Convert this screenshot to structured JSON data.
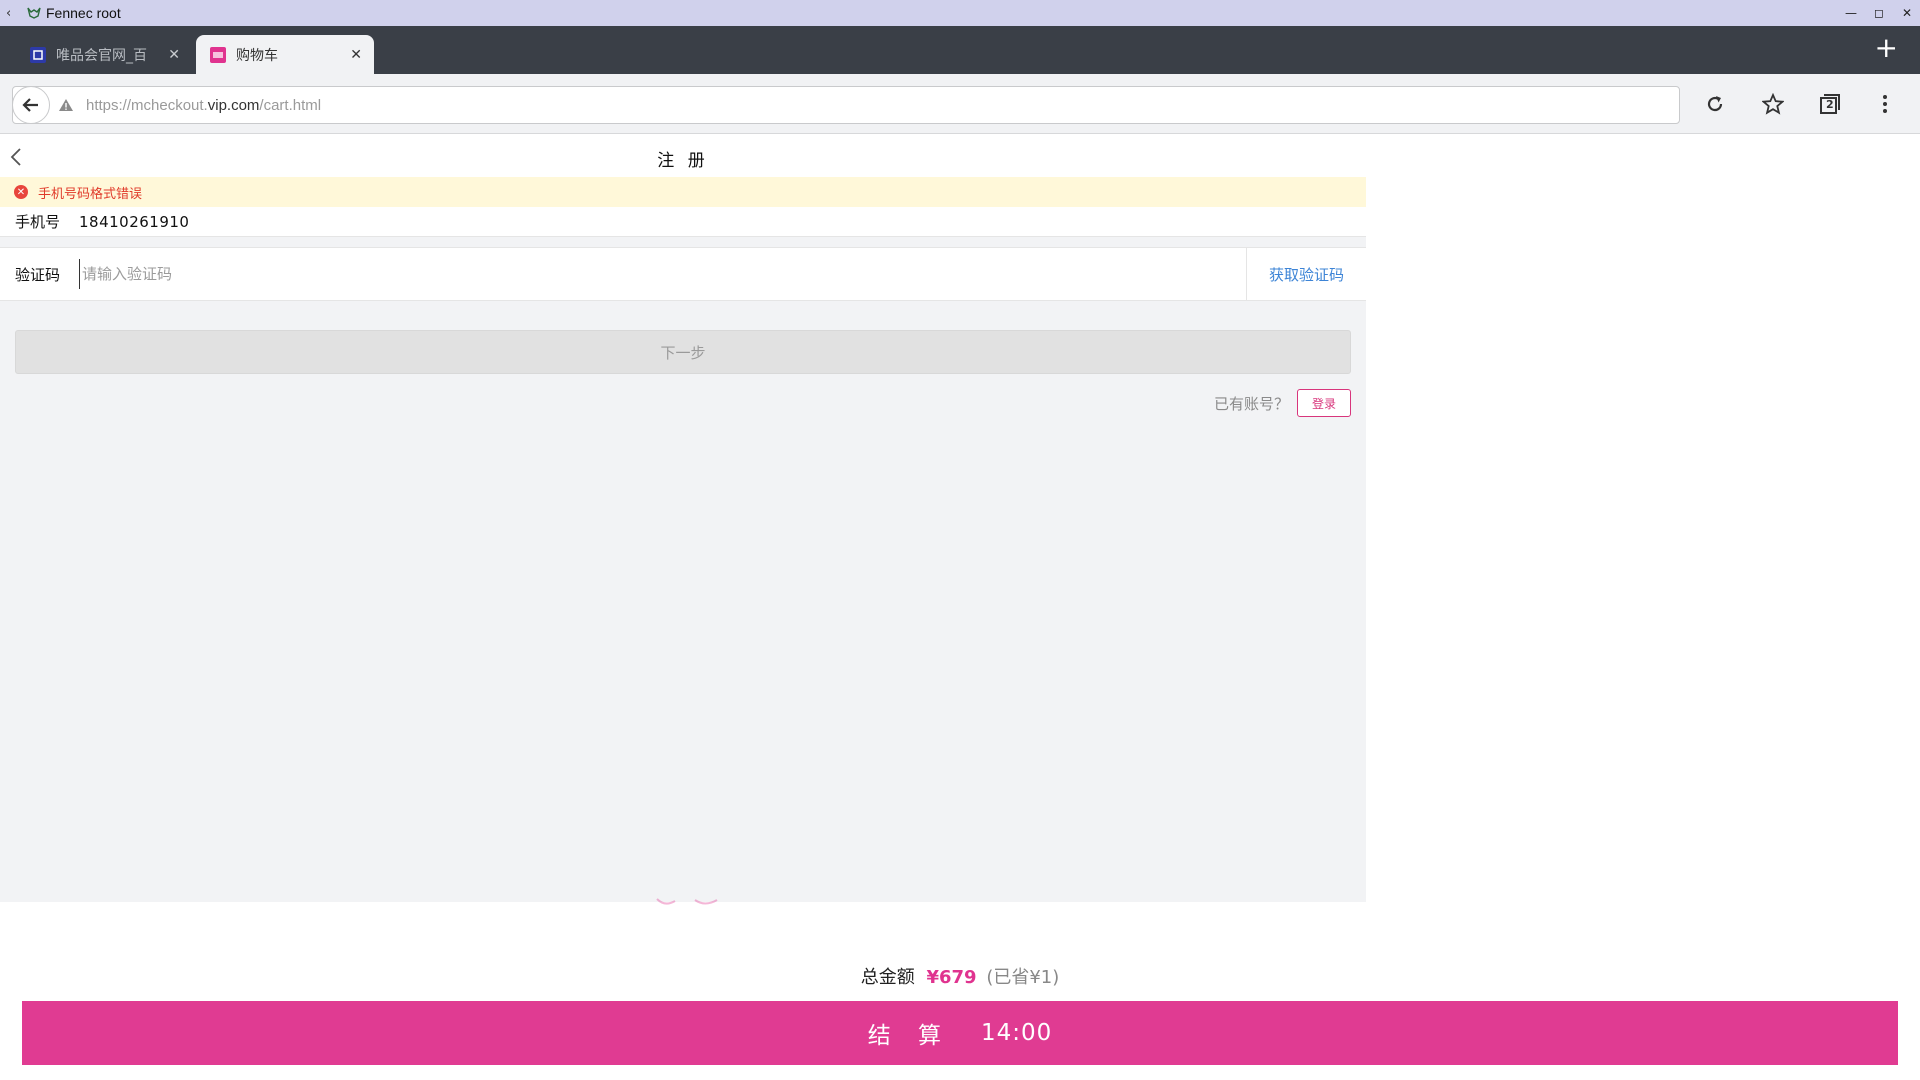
{
  "window": {
    "title": "Fennec root"
  },
  "tabs": [
    {
      "label": "唯品会官网_百",
      "active": false
    },
    {
      "label": "购物车",
      "active": true
    }
  ],
  "toolbar": {
    "url_prefix": "https://mcheckout.",
    "url_domain": "vip.com",
    "url_suffix": "/cart.html",
    "tab_count": "2"
  },
  "page": {
    "title": "注 册",
    "error_text": "手机号码格式错误",
    "phone_label": "手机号",
    "phone_value": "18410261910",
    "code_label": "验证码",
    "code_placeholder": "请输入验证码",
    "get_code_label": "获取验证码",
    "next_label": "下一步",
    "has_account_text": "已有账号？",
    "login_label": "登录"
  },
  "cart": {
    "total_label": "总金额",
    "total_amount": "¥679",
    "saved_text": "(已省¥1)",
    "checkout_label": "结 算",
    "countdown": "14:00"
  },
  "colors": {
    "accent": "#e03b92",
    "link": "#3d84d6",
    "error": "#e03a2a",
    "error_bg": "#fff8d9",
    "tabstrip": "#3a3f47",
    "titlebar": "#d0d1ec"
  }
}
